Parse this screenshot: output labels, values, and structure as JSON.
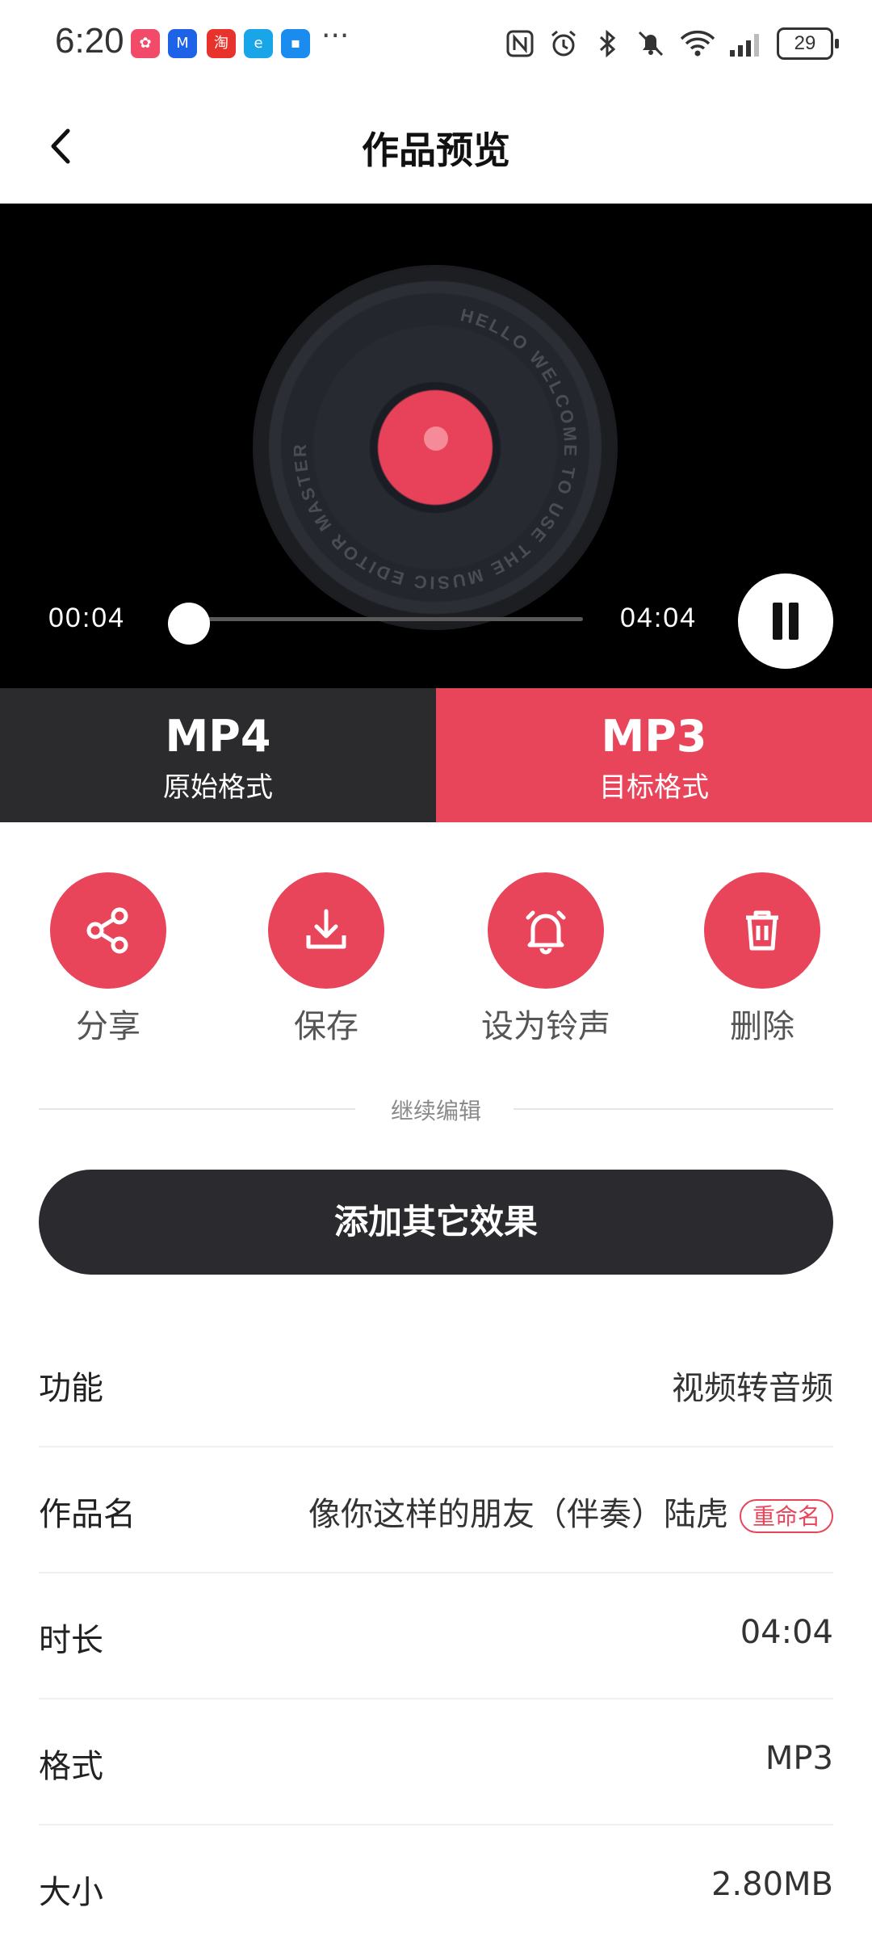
{
  "status_bar": {
    "time": "6:20",
    "more": "···",
    "battery": "29",
    "icons": [
      "nfc-icon",
      "alarm-icon",
      "bluetooth-icon",
      "mute-icon",
      "wifi-icon",
      "signal-icon"
    ]
  },
  "header": {
    "title": "作品预览"
  },
  "player": {
    "current_time": "00:04",
    "total_time": "04:04",
    "progress": 0.016,
    "disc_text": "HELLO WELCOME TO USE THE MUSIC EDITOR MASTER",
    "playing": true
  },
  "formats": {
    "original": {
      "main": "MP4",
      "sub": "原始格式"
    },
    "target": {
      "main": "MP3",
      "sub": "目标格式"
    }
  },
  "actions": [
    {
      "label": "分享",
      "icon": "share-icon"
    },
    {
      "label": "保存",
      "icon": "download-icon"
    },
    {
      "label": "设为铃声",
      "icon": "bell-icon"
    },
    {
      "label": "删除",
      "icon": "trash-icon"
    }
  ],
  "continue_edit": "继续编辑",
  "add_effect_button": "添加其它效果",
  "info": {
    "function": {
      "label": "功能",
      "value": "视频转音频"
    },
    "name": {
      "label": "作品名",
      "value": "像你这样的朋友（伴奏）陆虎",
      "rename": "重命名"
    },
    "duration": {
      "label": "时长",
      "value": "04:04"
    },
    "format": {
      "label": "格式",
      "value": "MP3"
    },
    "size": {
      "label": "大小",
      "value": "2.80MB"
    }
  },
  "colors": {
    "accent": "#e8455b",
    "dark": "#2b2b2d"
  }
}
